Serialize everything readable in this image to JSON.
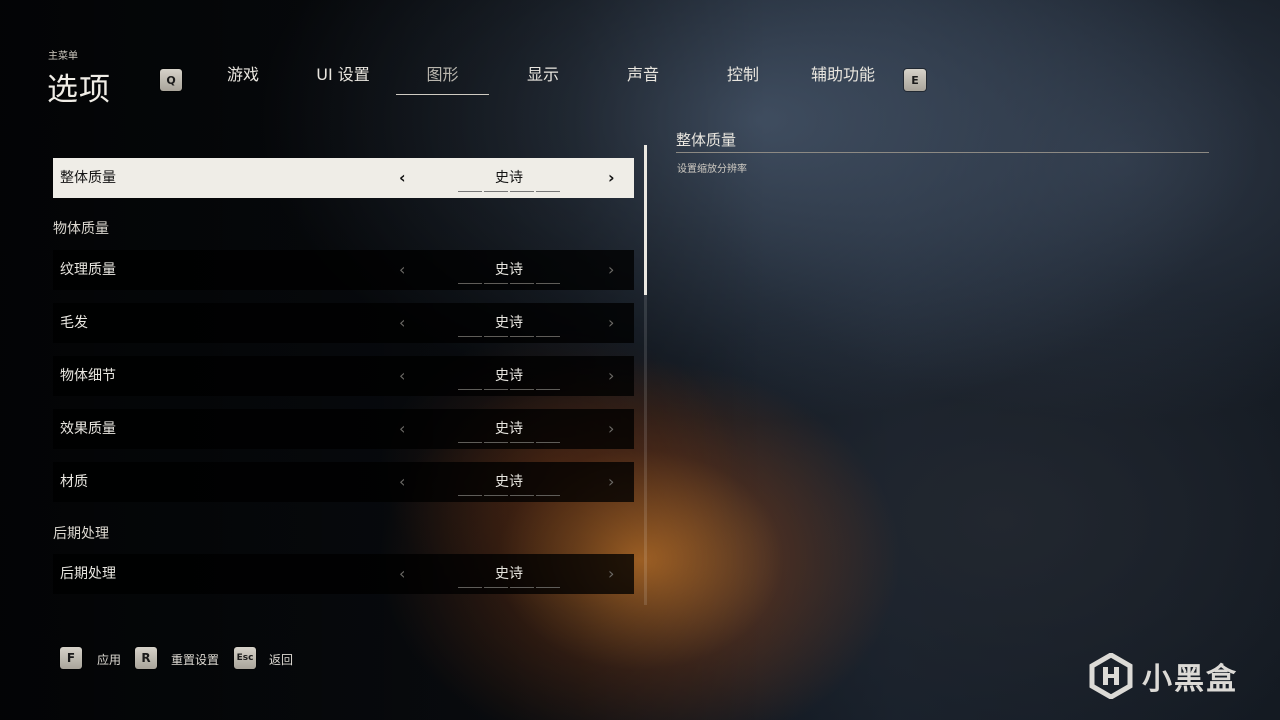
{
  "header": {
    "breadcrumb": "主菜单",
    "title": "选项",
    "prev_key": "Q",
    "next_key": "E",
    "tabs": [
      {
        "label": "游戏"
      },
      {
        "label": "UI 设置"
      },
      {
        "label": "图形"
      },
      {
        "label": "显示"
      },
      {
        "label": "声音"
      },
      {
        "label": "控制"
      },
      {
        "label": "辅助功能"
      }
    ],
    "active_tab": "图形"
  },
  "settings": {
    "overall": {
      "label": "整体质量",
      "value": "史诗"
    },
    "sections": [
      {
        "title": "物体质量",
        "rows": [
          {
            "label": "纹理质量",
            "value": "史诗"
          },
          {
            "label": "毛发",
            "value": "史诗"
          },
          {
            "label": "物体细节",
            "value": "史诗"
          },
          {
            "label": "效果质量",
            "value": "史诗"
          },
          {
            "label": "材质",
            "value": "史诗"
          }
        ]
      },
      {
        "title": "后期处理",
        "rows": [
          {
            "label": "后期处理",
            "value": "史诗"
          }
        ]
      }
    ]
  },
  "detail": {
    "title": "整体质量",
    "description": "设置缩放分辨率"
  },
  "footer": {
    "actions": [
      {
        "key": "F",
        "label": "应用"
      },
      {
        "key": "R",
        "label": "重置设置"
      },
      {
        "key": "Esc",
        "label": "返回"
      }
    ]
  },
  "watermark": {
    "text": "小黑盒"
  },
  "icons": {
    "left": "chevron-left-icon",
    "right": "chevron-right-icon"
  }
}
